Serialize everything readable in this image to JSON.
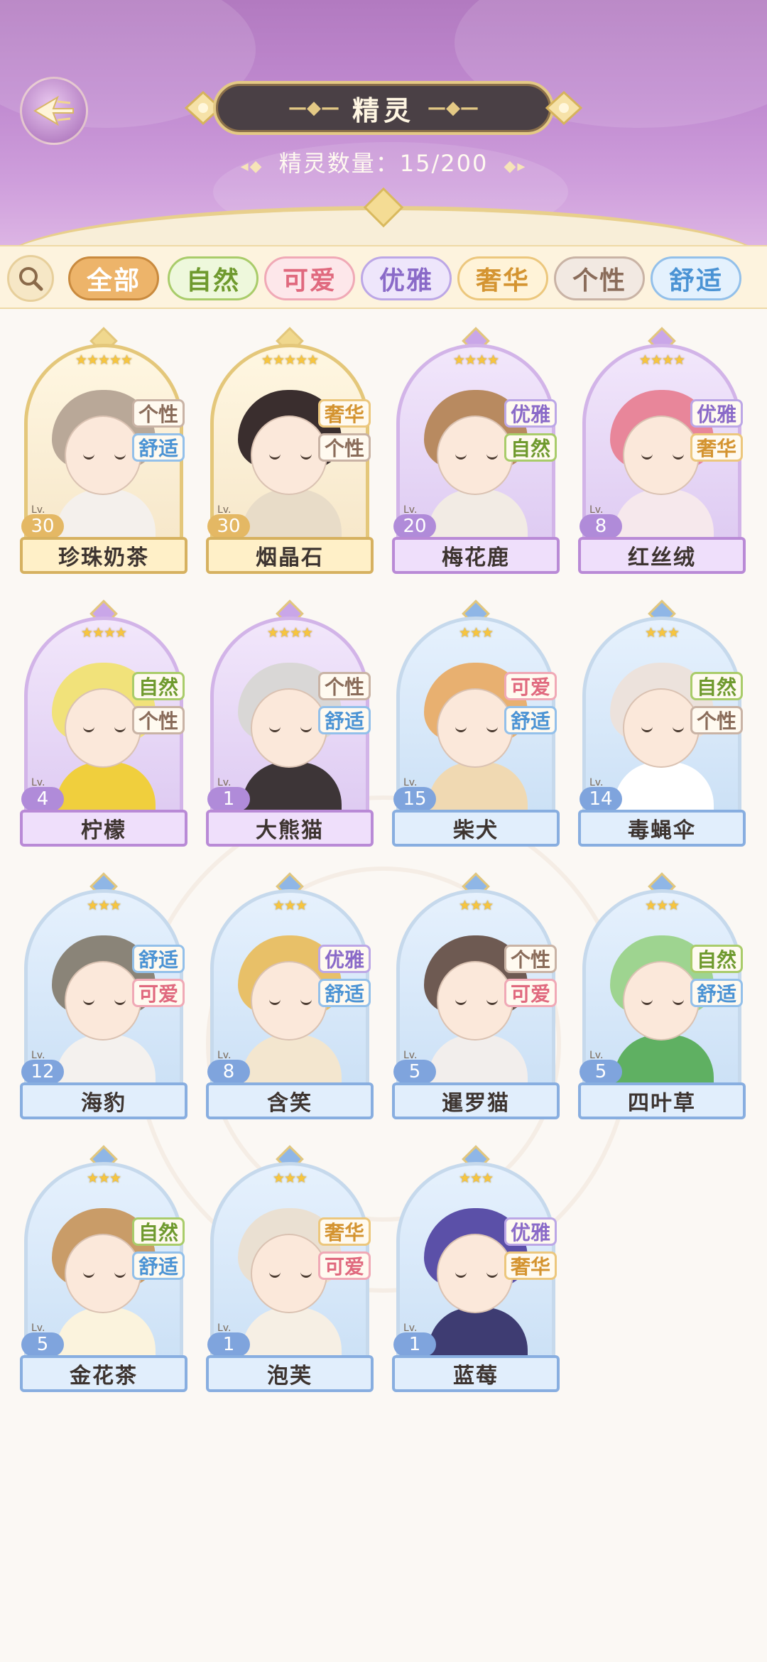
{
  "header": {
    "title": "精灵",
    "count_label": "精灵数量：",
    "count_value": "15/200"
  },
  "filters": [
    {
      "label": "全部",
      "active": true,
      "text_color": "#ffffff",
      "bg": "#edb46a",
      "border": "#c98a3e"
    },
    {
      "label": "自然",
      "active": false,
      "text_color": "#6f9a2e",
      "bg": "#eef8dc",
      "border": "#a9cc6a"
    },
    {
      "label": "可爱",
      "active": false,
      "text_color": "#e0697e",
      "bg": "#fde7ea",
      "border": "#f0a9b6"
    },
    {
      "label": "优雅",
      "active": false,
      "text_color": "#8a6ac8",
      "bg": "#eee6fb",
      "border": "#bca7e6"
    },
    {
      "label": "奢华",
      "active": false,
      "text_color": "#d49431",
      "bg": "#fff3d8",
      "border": "#ecc77d"
    },
    {
      "label": "个性",
      "active": false,
      "text_color": "#8a6c5a",
      "bg": "#f2e9e2",
      "border": "#c9b3a5"
    },
    {
      "label": "舒适",
      "active": false,
      "text_color": "#4b93d4",
      "bg": "#e4f1fd",
      "border": "#93c0ea"
    }
  ],
  "tag_colors": {
    "自然": {
      "text": "#6f9a2e",
      "border": "#a9cc6a"
    },
    "可爱": {
      "text": "#e0697e",
      "border": "#f0a9b6"
    },
    "优雅": {
      "text": "#8a6ac8",
      "border": "#bca7e6"
    },
    "奢华": {
      "text": "#d49431",
      "border": "#ecc77d"
    },
    "个性": {
      "text": "#8a6c5a",
      "border": "#c9b3a5"
    },
    "舒适": {
      "text": "#4b93d4",
      "border": "#93c0ea"
    }
  },
  "lv_label": "Lv.",
  "spirits": [
    {
      "name": "珍珠奶茶",
      "level": "30",
      "stars": 5,
      "tags": [
        "个性",
        "舒适"
      ],
      "hair": "#b9a898",
      "outfit": "#f4f0ec"
    },
    {
      "name": "烟晶石",
      "level": "30",
      "stars": 5,
      "tags": [
        "奢华",
        "个性"
      ],
      "hair": "#3a2e2e",
      "outfit": "#e8dcc8"
    },
    {
      "name": "梅花鹿",
      "level": "20",
      "stars": 4,
      "tags": [
        "优雅",
        "自然"
      ],
      "hair": "#b88a60",
      "outfit": "#f2ebe4"
    },
    {
      "name": "红丝绒",
      "level": "8",
      "stars": 4,
      "tags": [
        "优雅",
        "奢华"
      ],
      "hair": "#e8869a",
      "outfit": "#f6e8ec"
    },
    {
      "name": "柠檬",
      "level": "4",
      "stars": 4,
      "tags": [
        "自然",
        "个性"
      ],
      "hair": "#f1e27a",
      "outfit": "#f0cf3d"
    },
    {
      "name": "大熊猫",
      "level": "1",
      "stars": 4,
      "tags": [
        "个性",
        "舒适"
      ],
      "hair": "#d9d7d6",
      "outfit": "#3d3537"
    },
    {
      "name": "柴犬",
      "level": "15",
      "stars": 3,
      "tags": [
        "可爱",
        "舒适"
      ],
      "hair": "#e8b070",
      "outfit": "#f0d9b2"
    },
    {
      "name": "毒蝇伞",
      "level": "14",
      "stars": 3,
      "tags": [
        "自然",
        "个性"
      ],
      "hair": "#ece2dc",
      "outfit": "#ffffff"
    },
    {
      "name": "海豹",
      "level": "12",
      "stars": 3,
      "tags": [
        "舒适",
        "可爱"
      ],
      "hair": "#8a8478",
      "outfit": "#f4f1ee"
    },
    {
      "name": "含笑",
      "level": "8",
      "stars": 3,
      "tags": [
        "优雅",
        "舒适"
      ],
      "hair": "#e8c068",
      "outfit": "#f3e6cf"
    },
    {
      "name": "暹罗猫",
      "level": "5",
      "stars": 3,
      "tags": [
        "个性",
        "可爱"
      ],
      "hair": "#6e5a52",
      "outfit": "#f2eeec"
    },
    {
      "name": "四叶草",
      "level": "5",
      "stars": 3,
      "tags": [
        "自然",
        "舒适"
      ],
      "hair": "#9ed490",
      "outfit": "#5fb062"
    },
    {
      "name": "金花茶",
      "level": "5",
      "stars": 3,
      "tags": [
        "自然",
        "舒适"
      ],
      "hair": "#c99c68",
      "outfit": "#fbf3dd"
    },
    {
      "name": "泡芙",
      "level": "1",
      "stars": 3,
      "tags": [
        "奢华",
        "可爱"
      ],
      "hair": "#eae0d2",
      "outfit": "#f6efe4"
    },
    {
      "name": "蓝莓",
      "level": "1",
      "stars": 3,
      "tags": [
        "优雅",
        "奢华"
      ],
      "hair": "#5b50a8",
      "outfit": "#3e3c72"
    }
  ]
}
